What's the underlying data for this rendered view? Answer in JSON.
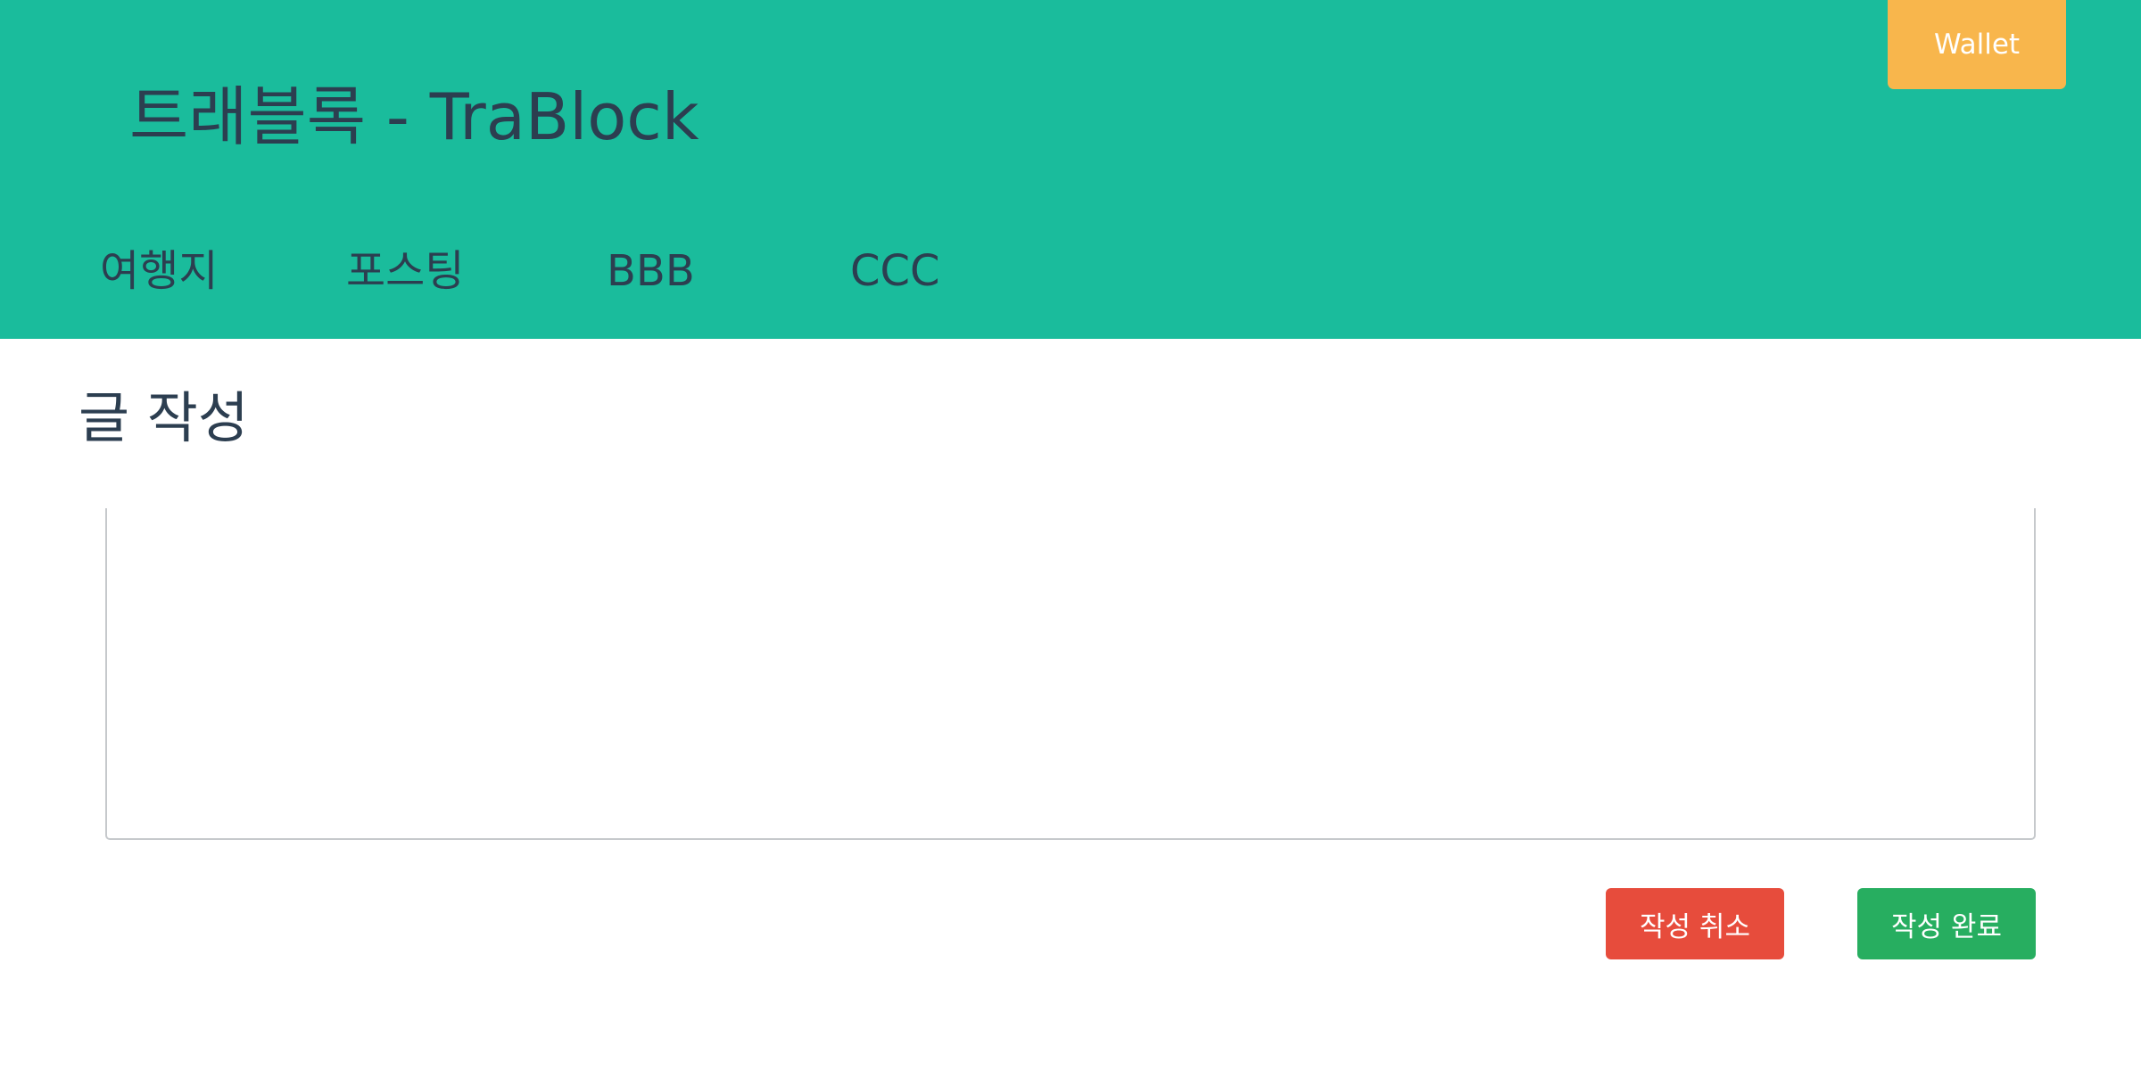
{
  "header": {
    "site_title": "트래블록 - TraBlock",
    "wallet_label": "Wallet",
    "nav": [
      {
        "label": "여행지"
      },
      {
        "label": "포스팅"
      },
      {
        "label": "BBB"
      },
      {
        "label": "CCC"
      }
    ]
  },
  "main": {
    "page_title": "글 작성",
    "editor": {
      "value": "",
      "placeholder": ""
    },
    "cancel_label": "작성 취소",
    "submit_label": "작성 완료"
  },
  "colors": {
    "header_bg": "#1abc9c",
    "wallet_bg": "#f8b64c",
    "cancel_bg": "#e74c3c",
    "submit_bg": "#27ae60",
    "text": "#2c3e50"
  }
}
